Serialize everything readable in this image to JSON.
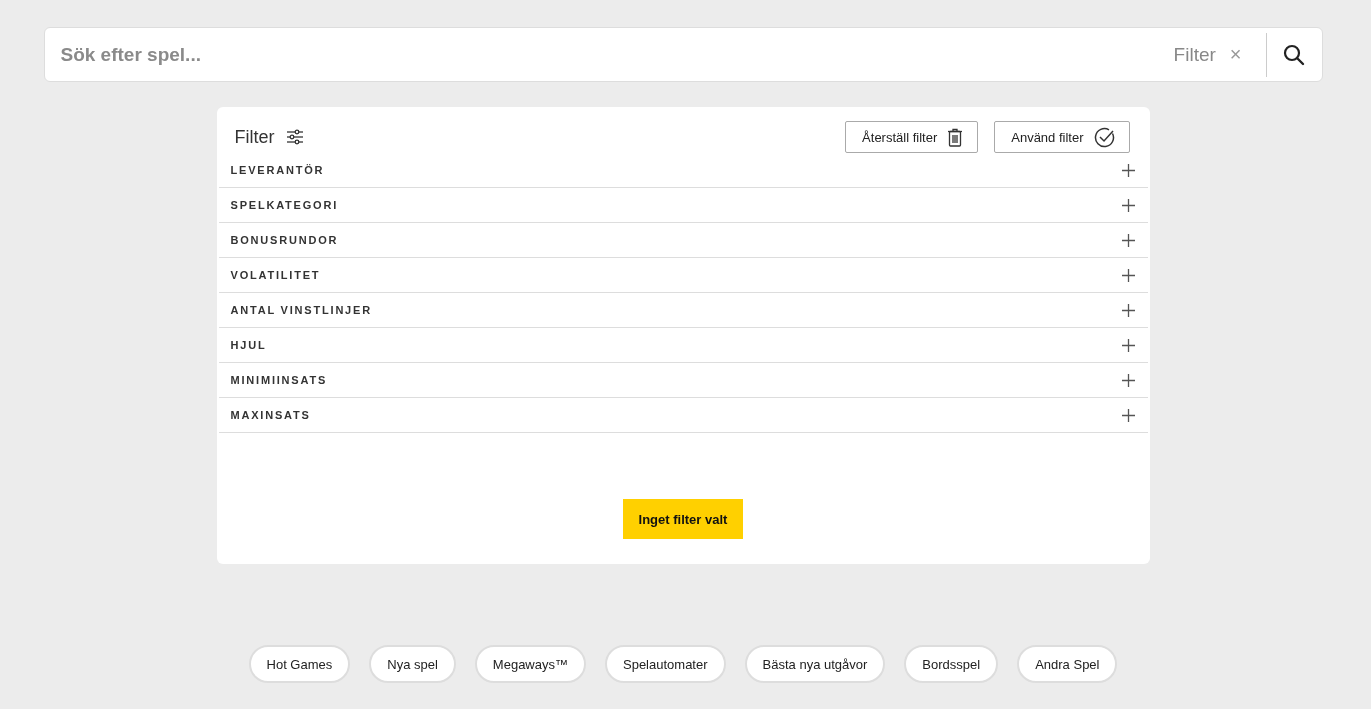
{
  "search": {
    "placeholder": "Sök efter spel...",
    "filter_label": "Filter",
    "clear": "×"
  },
  "filter_panel": {
    "title": "Filter",
    "reset_button": "Återställ filter",
    "apply_button": "Använd filter",
    "sections": [
      {
        "label": "LEVERANTÖR",
        "expanded": false
      },
      {
        "label": "SPELKATEGORI",
        "expanded": false
      },
      {
        "label": "BONUSRUNDOR",
        "expanded": false
      },
      {
        "label": "VOLATILITET",
        "expanded": false
      },
      {
        "label": "ANTAL VINSTLINJER",
        "expanded": false
      },
      {
        "label": "HJUL",
        "expanded": false
      },
      {
        "label": "MINIMIINSATS",
        "expanded": false
      },
      {
        "label": "MAXINSATS",
        "expanded": false
      }
    ],
    "status_button": "Inget filter valt"
  },
  "categories": [
    "Hot Games",
    "Nya spel",
    "Megaways™",
    "Spelautomater",
    "Bästa nya utgåvor",
    "Bordsspel",
    "Andra Spel"
  ]
}
